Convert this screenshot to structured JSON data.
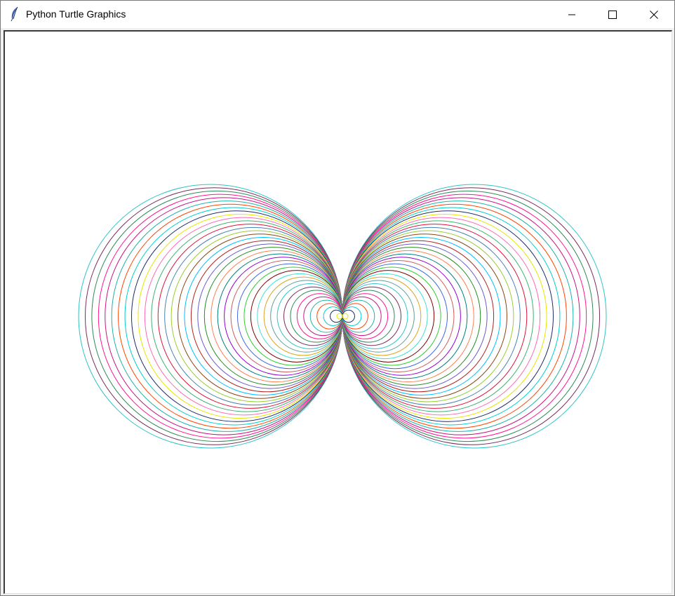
{
  "window": {
    "title": "Python Turtle Graphics",
    "icon": "feather-icon",
    "controls": {
      "minimize_icon": "minimize-icon",
      "maximize_icon": "maximize-icon",
      "close_icon": "close-icon"
    }
  },
  "canvas": {
    "background": "#ffffff",
    "pattern": "mirrored nested circle pairs",
    "circle_count_per_side": 40,
    "palette": [
      "#2ec4c9",
      "#7a2c5a",
      "#2e8b57",
      "#ff1493",
      "#c71585",
      "#20b2aa",
      "#ff4500",
      "#00ced1",
      "#1f2a6b",
      "#e5e500",
      "#ff69b4",
      "#3cb371",
      "#dc143c",
      "#4682b4",
      "#9acd32",
      "#8b4513",
      "#00bfff",
      "#b22222",
      "#6a5acd",
      "#228b22",
      "#ff7f50",
      "#008080",
      "#9400d3",
      "#cd5c5c",
      "#4169e1",
      "#32cd32",
      "#800000",
      "#40e0d0",
      "#daa520",
      "#5f9ea0"
    ]
  }
}
